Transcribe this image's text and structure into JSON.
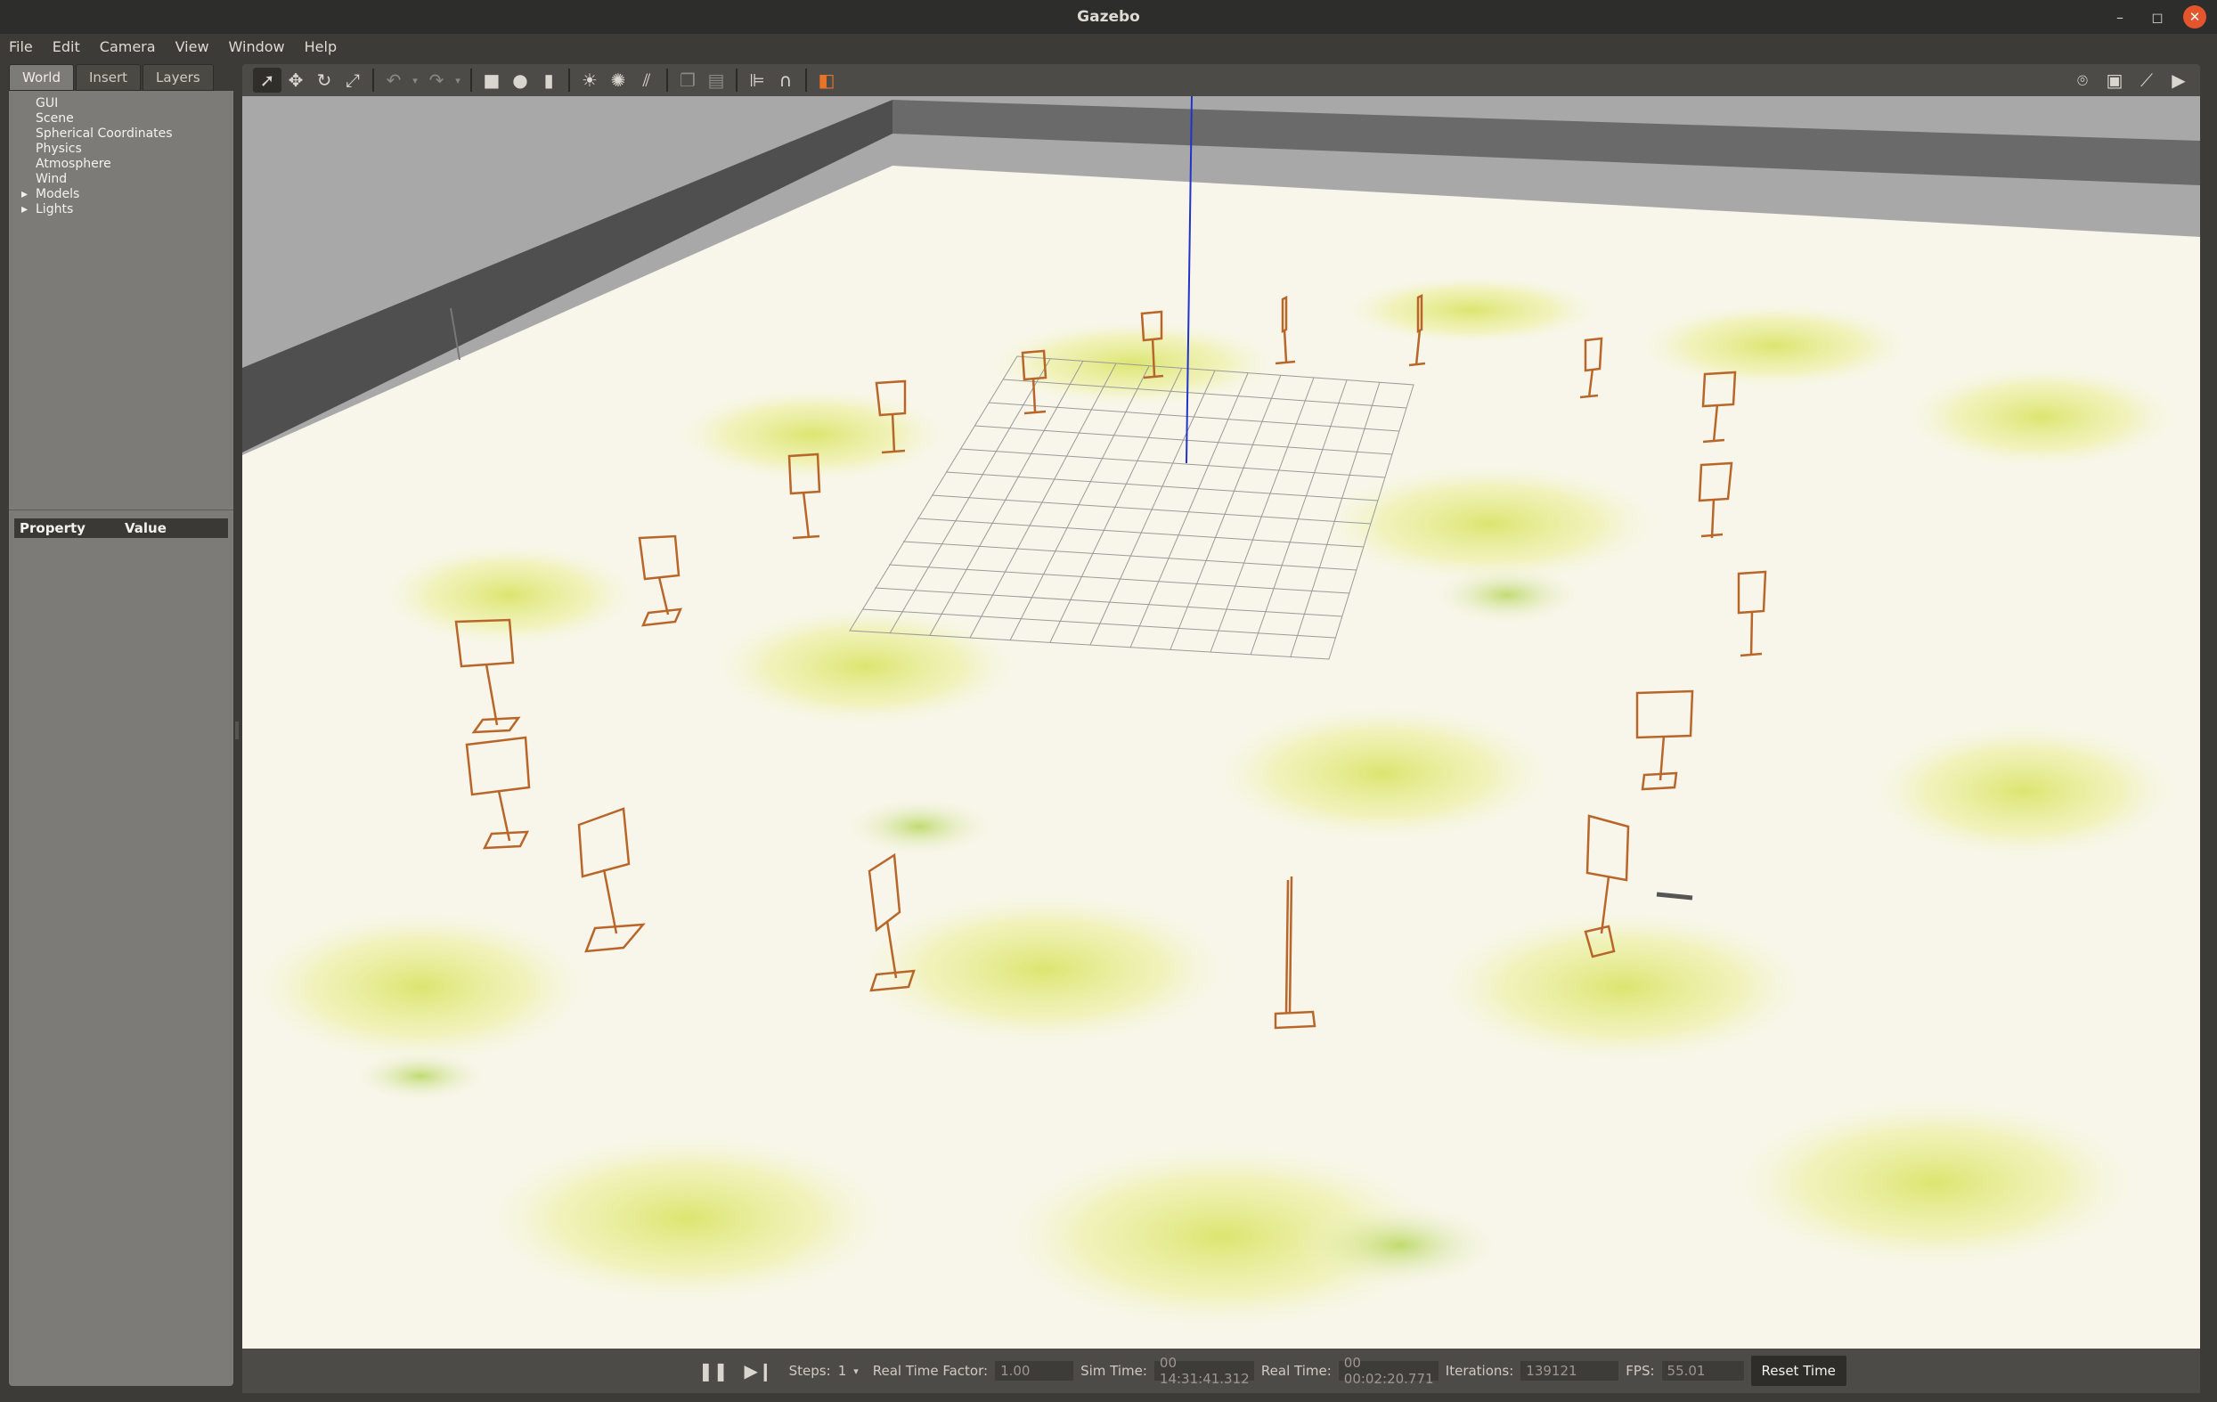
{
  "window": {
    "title": "Gazebo"
  },
  "menu": [
    "File",
    "Edit",
    "Camera",
    "View",
    "Window",
    "Help"
  ],
  "left_tabs": [
    "World",
    "Insert",
    "Layers"
  ],
  "world_tree": [
    {
      "label": "GUI",
      "expandable": false
    },
    {
      "label": "Scene",
      "expandable": false
    },
    {
      "label": "Spherical Coordinates",
      "expandable": false
    },
    {
      "label": "Physics",
      "expandable": false
    },
    {
      "label": "Atmosphere",
      "expandable": false
    },
    {
      "label": "Wind",
      "expandable": false
    },
    {
      "label": "Models",
      "expandable": true
    },
    {
      "label": "Lights",
      "expandable": true
    }
  ],
  "properties": {
    "col_property": "Property",
    "col_value": "Value"
  },
  "toolbar": {
    "tools": [
      "select-icon",
      "translate-icon",
      "rotate-icon",
      "scale-icon",
      "undo-icon",
      "redo-icon",
      "box-icon",
      "sphere-icon",
      "cylinder-icon",
      "point-light-icon",
      "spot-light-icon",
      "directional-light-icon",
      "copy-icon",
      "paste-icon",
      "align-icon",
      "snap-icon",
      "view-angle-icon"
    ],
    "right_tools": [
      "screenshot-icon",
      "log-icon",
      "plot-icon",
      "record-icon"
    ]
  },
  "status": {
    "steps_label": "Steps:",
    "steps_value": "1",
    "rtf_label": "Real Time Factor:",
    "rtf_value": "1.00",
    "sim_label": "Sim Time:",
    "sim_value": "00 14:31:41.312",
    "real_label": "Real Time:",
    "real_value": "00 00:02:20.771",
    "iter_label": "Iterations:",
    "iter_value": "139121",
    "fps_label": "FPS:",
    "fps_value": "55.01",
    "reset_label": "Reset Time"
  },
  "colors": {
    "ground": "#f8f6ea",
    "wall": "#565656",
    "sky": "#a9a9a9",
    "frame": "#b8662a",
    "grid": "#9a9a9a",
    "zaxis": "#2233cc"
  }
}
